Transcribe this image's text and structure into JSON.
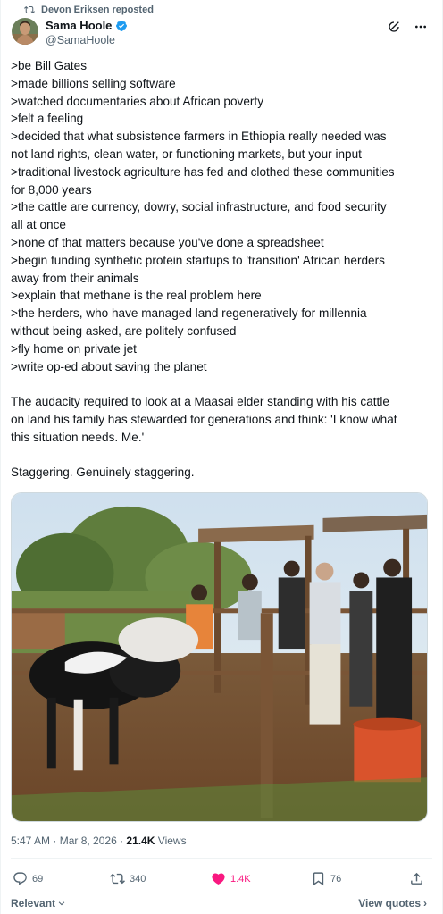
{
  "repost": {
    "text": "Devon Eriksen reposted",
    "icon": "repost-icon"
  },
  "author": {
    "name": "Sama Hoole",
    "handle": "@SamaHoole",
    "verified": true,
    "verified_color": "#1d9bf0"
  },
  "top_actions": {
    "grok_icon": "grok-icon",
    "more_icon": "more-dots-icon"
  },
  "tweet": {
    "lines": [
      ">be Bill Gates",
      ">made billions selling software",
      ">watched documentaries about African poverty",
      ">felt a feeling",
      ">decided that what subsistence farmers in Ethiopia really needed was",
      "not land rights, clean water, or functioning markets, but your input",
      ">traditional livestock agriculture has fed and clothed these communities",
      "for 8,000 years",
      ">the cattle are currency, dowry, social infrastructure, and food security",
      "all at once",
      ">none of that matters because you've done a spreadsheet",
      ">begin funding synthetic protein startups to 'transition' African herders",
      "away from their animals",
      ">explain that methane is the real problem here",
      ">the herders, who have managed land regeneratively for millennia",
      "without being asked, are politely confused",
      ">fly home on private jet",
      ">write op-ed about saving the planet",
      "",
      "The audacity required to look at a Maasai elder standing with his cattle",
      "on land his family has stewarded for generations and think: 'I know what",
      "this situation needs. Me.'",
      "",
      "Staggering. Genuinely staggering."
    ]
  },
  "meta": {
    "time": "5:47 AM",
    "separator": " · ",
    "date": "Mar 8, 2026",
    "views_count": "21.4K",
    "views_label": " Views"
  },
  "actions": {
    "replies": "69",
    "reposts": "340",
    "likes": "1.4K",
    "bookmarks": "76",
    "like_color": "#f91880"
  },
  "footer": {
    "sort_label": "Relevant",
    "view_quotes_label": "View quotes"
  }
}
